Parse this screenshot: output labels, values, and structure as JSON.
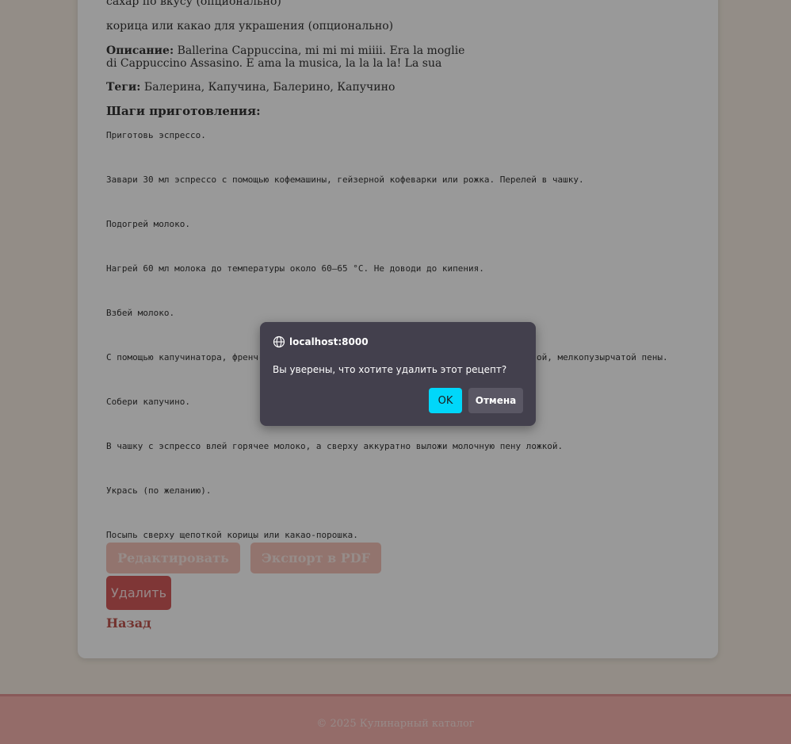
{
  "recipe": {
    "ingredients": [
      "сахар по вкусу (опционально)",
      "корица или какао для украшения (опционально)"
    ],
    "description_label": "Описание:",
    "description": "Ballerina Cappuccina, mi mi mi miiii. Era la moglie di Cappuccino Assasino. E ama la musica, la la la la! La sua",
    "tags_label": "Теги:",
    "tags": "Балерина, Капучина, Балерино, Капучино",
    "steps_heading": "Шаги приготовления:",
    "steps": [
      "Приготовь эспрессо.",
      "Завари 30 мл эспрессо с помощью кофемашины, гейзерной кофеварки или рожка. Перелей в чашку.",
      "Подогрей молоко.",
      "Нагрей 60 мл молока до температуры около 60–65 °C. Не доводи до кипения.",
      "Взбей молоко.",
      "С помощью капучинатора, френч-пресса или венчика взбей молоко до образования плотной, мелкопузырчатой пены.",
      "Собери капучино.",
      "В чашку с эспрессо влей горячее молоко, а сверху аккуратно выложи молочную пену ложкой.",
      "Укрась (по желанию).",
      "Посыпь сверху щепоткой корицы или какао-порошка."
    ]
  },
  "actions": {
    "edit": "Редактировать",
    "export_pdf": "Экспорт в PDF",
    "delete": "Удалить",
    "back": "Назад"
  },
  "footer": {
    "text": "© 2025 Кулинарный каталог"
  },
  "dialog": {
    "origin": "localhost:8000",
    "message": "Вы уверены, что хотите удалить этот рецепт?",
    "ok": "OK",
    "cancel": "Отмена",
    "origin_icon": "globe-icon"
  },
  "colors": {
    "accent": "#f3c1b8",
    "danger": "#d45a5a",
    "dialog_ok": "#00d7fa",
    "footer": "#f7b4b0"
  }
}
